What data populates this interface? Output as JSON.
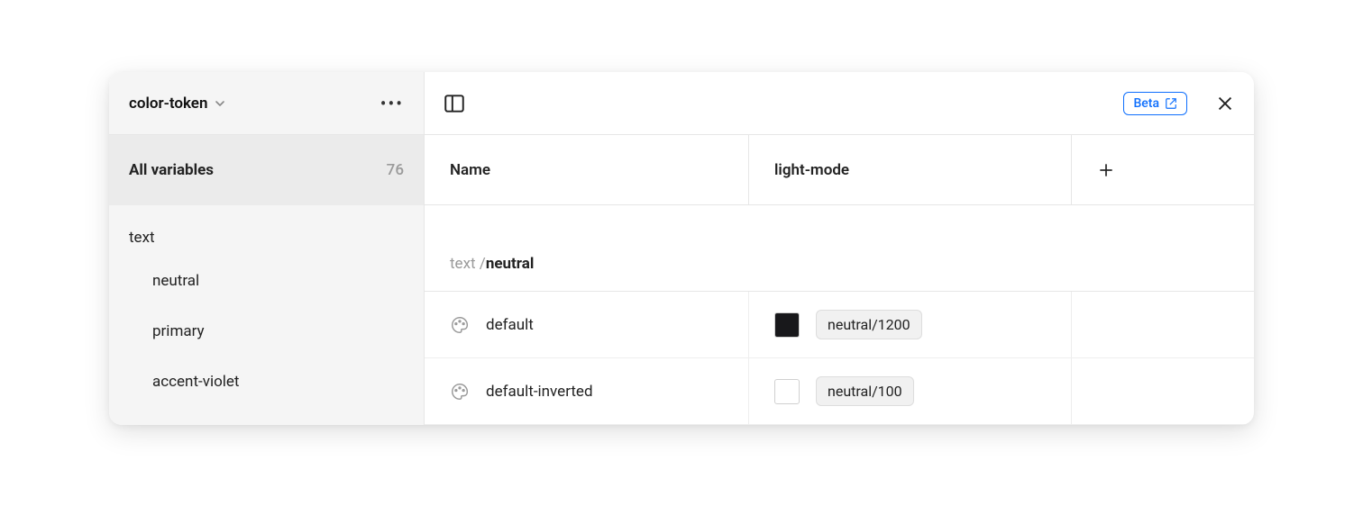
{
  "collection": {
    "name": "color-token"
  },
  "sidebar": {
    "all_label": "All variables",
    "count": "76",
    "groups": [
      {
        "label": "text",
        "children": [
          {
            "label": "neutral"
          },
          {
            "label": "primary"
          },
          {
            "label": "accent-violet"
          }
        ]
      }
    ]
  },
  "header": {
    "beta_label": "Beta",
    "name_col": "Name",
    "mode_col": "light-mode"
  },
  "group_path": {
    "prefix": "text / ",
    "name": "neutral"
  },
  "variables": [
    {
      "name": "default",
      "swatch_color": "#18181b",
      "value_label": "neutral/1200"
    },
    {
      "name": "default-inverted",
      "swatch_color": "#ffffff",
      "value_label": "neutral/100"
    }
  ]
}
